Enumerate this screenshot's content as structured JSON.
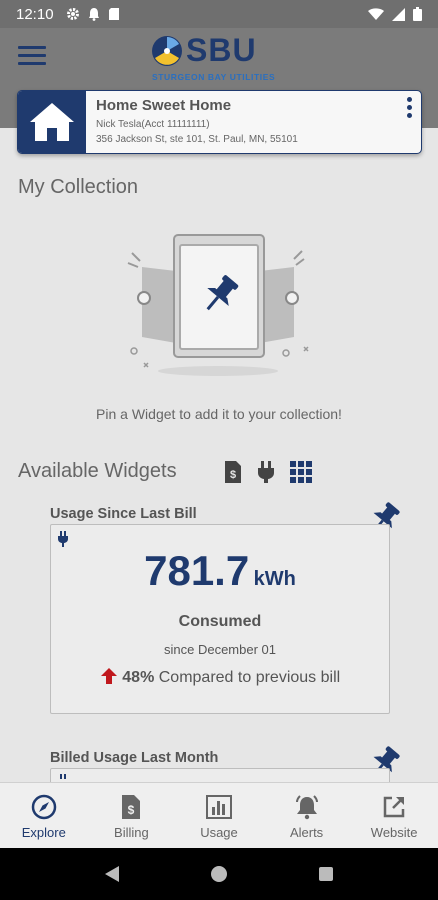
{
  "status_bar": {
    "time": "12:10"
  },
  "app_bar": {
    "logo_text": "SBU",
    "logo_subtitle": "STURGEON BAY UTILITIES"
  },
  "account": {
    "name": "Home Sweet Home",
    "holder": "Nick Tesla(Acct 11111111)",
    "address": "356 Jackson St, ste 101, St. Paul, MN, 55101"
  },
  "collection": {
    "title": "My Collection",
    "empty_message": "Pin a Widget to add it to your collection!"
  },
  "available": {
    "title": "Available Widgets",
    "filter_icons": [
      "billing-filter-icon",
      "plug-filter-icon",
      "grid-filter-icon"
    ]
  },
  "widgets": [
    {
      "label": "Usage Since Last Bill",
      "value": "781.7",
      "unit": "kWh",
      "status": "Consumed",
      "since": "since December 01",
      "change_pct": "48%",
      "change_text": "Compared to previous bill"
    },
    {
      "label": "Billed Usage Last Month"
    }
  ],
  "bottom_nav": [
    {
      "label": "Explore",
      "icon": "compass-icon"
    },
    {
      "label": "Billing",
      "icon": "bill-icon"
    },
    {
      "label": "Usage",
      "icon": "bar-chart-icon"
    },
    {
      "label": "Alerts",
      "icon": "bell-icon"
    },
    {
      "label": "Website",
      "icon": "external-link-icon"
    }
  ],
  "colors": {
    "brand": "#1f3a6e",
    "accent_red": "#c0181d",
    "background": "#e6e6e6"
  }
}
